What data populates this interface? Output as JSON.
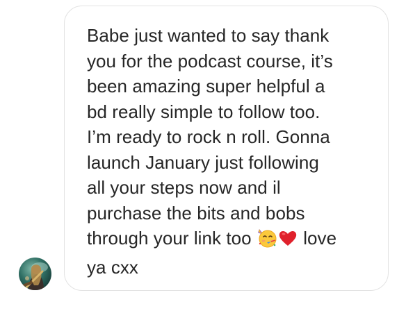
{
  "message": {
    "lines": [
      "Babe just wanted to say thank",
      "you for the podcast course, it’s",
      "been amazing super helpful a",
      "bd really simple to follow too.",
      "I’m ready to rock n roll. Gonna",
      "launch January just following",
      "all your steps now and il",
      "purchase the bits and bobs"
    ],
    "line9_before": "through your link too",
    "line9_after": "love",
    "line10": "ya cxx",
    "emojis": [
      "partying-face",
      "red-heart"
    ]
  },
  "sender": {
    "avatar_icon": "profile-photo"
  },
  "colors": {
    "text": "#262626",
    "bubble_border": "#e2e2e2",
    "heart": "#e0212c"
  }
}
